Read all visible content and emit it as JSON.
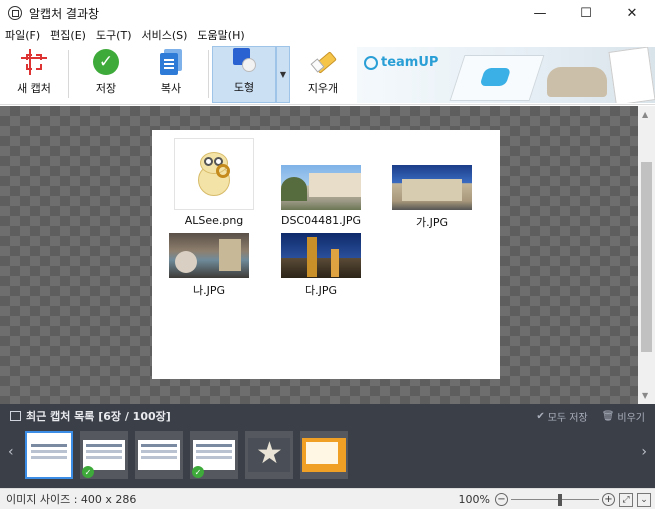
{
  "window": {
    "title": "알캡처 결과창",
    "minimize": "—",
    "maximize": "☐",
    "close": "✕"
  },
  "menu": [
    "파일(F)",
    "편집(E)",
    "도구(T)",
    "서비스(S)",
    "도움말(H)"
  ],
  "toolbar": {
    "new_capture": "새 캡처",
    "save": "저장",
    "copy": "복사",
    "shape": "도형",
    "eraser": "지우개"
  },
  "banner": {
    "brand": "teamUP"
  },
  "captured_files": [
    {
      "name": "ALSee.png"
    },
    {
      "name": "DSC04481.JPG"
    },
    {
      "name": "가.JPG"
    },
    {
      "name": "나.JPG"
    },
    {
      "name": "다.JPG"
    }
  ],
  "recent": {
    "title": "최근 캡처 목록 [6장 / 100장]",
    "save_all": "모두 저장",
    "clear": "비우기",
    "prev": "‹",
    "next": "›",
    "items": [
      {
        "selected": true,
        "saved": false
      },
      {
        "selected": false,
        "saved": true
      },
      {
        "selected": false,
        "saved": false
      },
      {
        "selected": false,
        "saved": true
      },
      {
        "selected": false,
        "saved": false
      },
      {
        "selected": false,
        "saved": false
      }
    ]
  },
  "status": {
    "image_size": "이미지 사이즈 : 400 x 286",
    "zoom": "100%",
    "zoom_level": 1.0
  },
  "colors": {
    "accent": "#3b8de5",
    "panel_bg": "#3b3f48",
    "save_green": "#3daa3a"
  }
}
